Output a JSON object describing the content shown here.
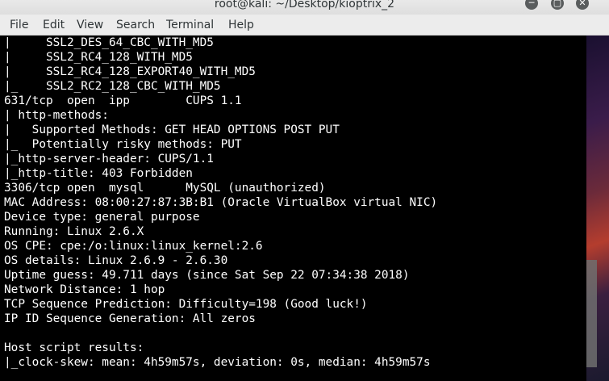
{
  "window": {
    "title": "root@kali: ~/Desktop/kioptrix_2",
    "minimize_glyph": "─",
    "maximize_glyph": "▢",
    "close_glyph": "✕"
  },
  "menu": {
    "items": [
      {
        "label": "File"
      },
      {
        "label": "Edit"
      },
      {
        "label": "View"
      },
      {
        "label": "Search"
      },
      {
        "label": "Terminal"
      },
      {
        "label": "Help"
      }
    ]
  },
  "terminal": {
    "lines": [
      "|     SSL2_DES_64_CBC_WITH_MD5",
      "|     SSL2_RC4_128_WITH_MD5",
      "|     SSL2_RC4_128_EXPORT40_WITH_MD5",
      "|_    SSL2_RC2_128_CBC_WITH_MD5",
      "631/tcp  open  ipp        CUPS 1.1",
      "| http-methods:",
      "|   Supported Methods: GET HEAD OPTIONS POST PUT",
      "|_  Potentially risky methods: PUT",
      "|_http-server-header: CUPS/1.1",
      "|_http-title: 403 Forbidden",
      "3306/tcp open  mysql      MySQL (unauthorized)",
      "MAC Address: 08:00:27:87:3B:B1 (Oracle VirtualBox virtual NIC)",
      "Device type: general purpose",
      "Running: Linux 2.6.X",
      "OS CPE: cpe:/o:linux:linux_kernel:2.6",
      "OS details: Linux 2.6.9 - 2.6.30",
      "Uptime guess: 49.711 days (since Sat Sep 22 07:34:38 2018)",
      "Network Distance: 1 hop",
      "TCP Sequence Prediction: Difficulty=198 (Good luck!)",
      "IP ID Sequence Generation: All zeros",
      "",
      "Host script results:",
      "|_clock-skew: mean: 4h59m57s, deviation: 0s, median: 4h59m57s"
    ]
  },
  "colors": {
    "terminal_background": "#000000",
    "terminal_foreground": "#ffffff",
    "titlebar_background": "#e4e4e4",
    "menubar_background": "#ececec"
  }
}
